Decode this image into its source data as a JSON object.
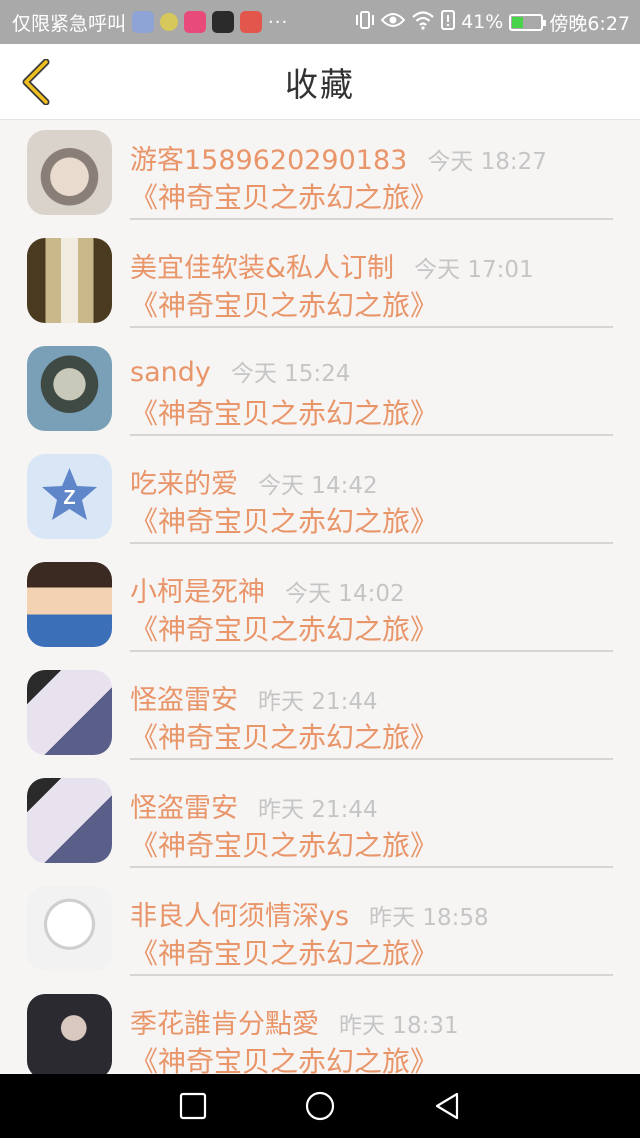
{
  "status_bar": {
    "left_text": "仅限紧急呼叫",
    "more": "···",
    "battery_percent": "41%",
    "time": "傍晚6:27",
    "battery_level": 0.41
  },
  "header": {
    "title": "收藏",
    "back_icon": "chevron-left-icon"
  },
  "favorites": [
    {
      "name": "游客1589620290183",
      "time": "今天 18:27",
      "work": "《神奇宝贝之赤幻之旅》"
    },
    {
      "name": "美宜佳软装&私人订制",
      "time": "今天 17:01",
      "work": "《神奇宝贝之赤幻之旅》"
    },
    {
      "name": "sandy",
      "time": "今天 15:24",
      "work": "《神奇宝贝之赤幻之旅》"
    },
    {
      "name": "吃来的爱",
      "time": "今天 14:42",
      "work": "《神奇宝贝之赤幻之旅》"
    },
    {
      "name": "小柯是死神",
      "time": "今天 14:02",
      "work": "《神奇宝贝之赤幻之旅》"
    },
    {
      "name": "怪盗雷安",
      "time": "昨天 21:44",
      "work": "《神奇宝贝之赤幻之旅》"
    },
    {
      "name": "怪盗雷安",
      "time": "昨天 21:44",
      "work": "《神奇宝贝之赤幻之旅》"
    },
    {
      "name": "非良人何须情深ys",
      "time": "昨天 18:58",
      "work": "《神奇宝贝之赤幻之旅》"
    },
    {
      "name": "季花誰肯分點愛",
      "time": "昨天 18:31",
      "work": "《神奇宝贝之赤幻之旅》"
    }
  ],
  "nav_bar": {
    "recents_icon": "square-icon",
    "home_icon": "circle-icon",
    "back_icon": "triangle-back-icon"
  },
  "colors": {
    "accent": "#e9956a",
    "time_text": "#c5c5c5",
    "back_chevron": "#f0c020"
  }
}
